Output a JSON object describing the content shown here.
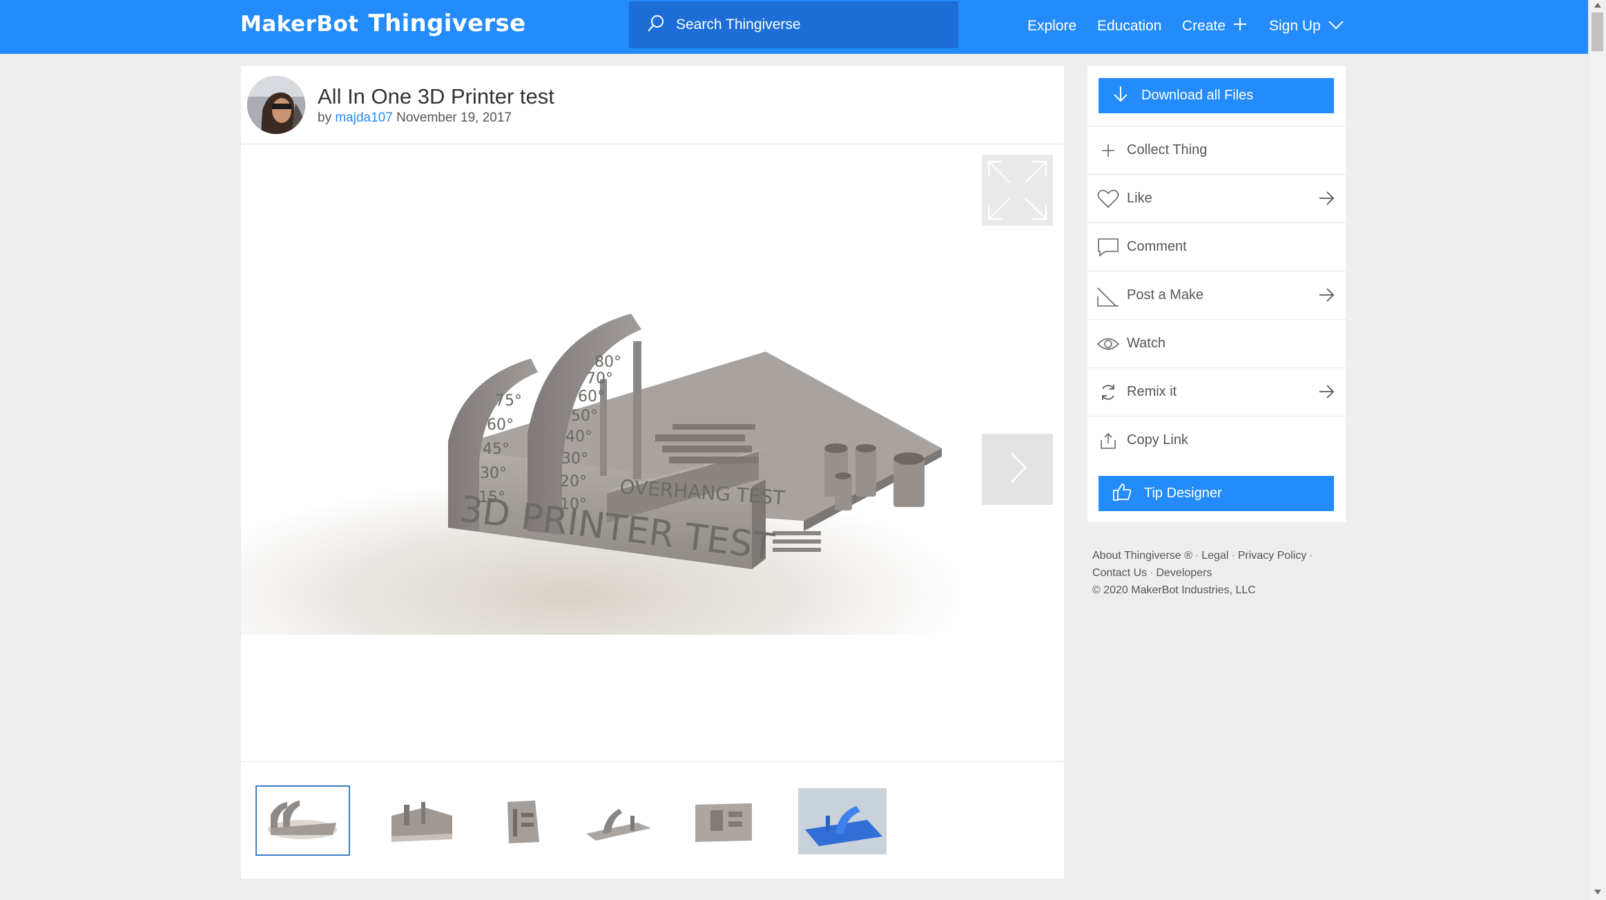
{
  "header": {
    "logo_brand": "MakerBot",
    "logo_product": "Thingiverse",
    "search_placeholder": "Search Thingiverse",
    "nav": {
      "explore": "Explore",
      "education": "Education",
      "create": "Create",
      "signup": "Sign Up"
    }
  },
  "thing": {
    "title": "All In One 3D Printer test",
    "by": "by",
    "author": "majda107",
    "date": "November 19, 2017",
    "render_text": {
      "base": "3D PRINTER TEST",
      "plate": "OVERHANG TEST",
      "arc_small": [
        "75°",
        "60°",
        "45°",
        "30°",
        "15°"
      ],
      "arc_large": [
        "80°",
        "70°",
        "60°",
        "50°",
        "40°",
        "30°",
        "20°",
        "10°"
      ]
    },
    "thumbnail_count": 6
  },
  "sidebar": {
    "download_label": "Download all Files",
    "actions": [
      {
        "label": "Collect Thing",
        "icon": "plus-icon",
        "has_arrow": false
      },
      {
        "label": "Like",
        "icon": "heart-icon",
        "has_arrow": true
      },
      {
        "label": "Comment",
        "icon": "comment-icon",
        "has_arrow": false
      },
      {
        "label": "Post a Make",
        "icon": "make-icon",
        "has_arrow": true
      },
      {
        "label": "Watch",
        "icon": "eye-icon",
        "has_arrow": false
      },
      {
        "label": "Remix it",
        "icon": "remix-icon",
        "has_arrow": true
      },
      {
        "label": "Copy Link",
        "icon": "share-icon",
        "has_arrow": false
      }
    ],
    "tip_label": "Tip Designer"
  },
  "footer": {
    "about": "About Thingiverse ®",
    "legal": "Legal",
    "privacy": "Privacy Policy",
    "contact": "Contact Us",
    "developers": "Developers",
    "copyright": "©  2020 MakerBot Industries, LLC"
  },
  "colors": {
    "brand_blue": "#248bfb",
    "search_bg": "#1c6ed6",
    "page_bg": "#eeeeee",
    "model_gray": "#9a9591"
  }
}
